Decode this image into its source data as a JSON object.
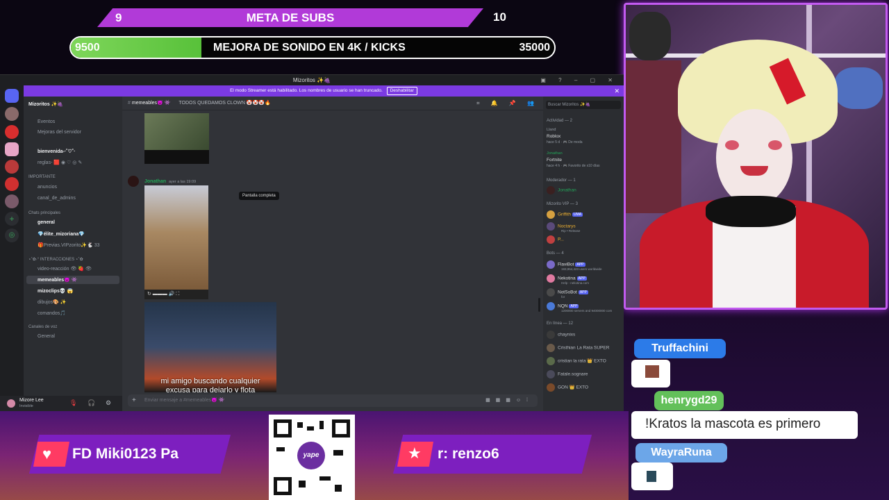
{
  "overlay": {
    "subs_goal": {
      "left": "9",
      "title": "META DE SUBS",
      "right": "10"
    },
    "kicks_goal": {
      "current": "9500",
      "title": "MEJORA DE SONIDO EN 4K / KICKS",
      "target": "35000",
      "progress": 0.27
    }
  },
  "discord": {
    "window_title": "Mizoritos ✨🍇",
    "banner": {
      "text": "El modo Streamer está habilitado. Los nombres de usuario se han truncado.",
      "button": "Deshabilitar"
    },
    "server_name": "Mizoritos ✨🍇",
    "sidebar": {
      "events": "Eventos",
      "boost": "Mejoras del servidor",
      "channels_top": [
        "bienvenida-‧˚♡˚‧",
        "reglas- 🟥 ◉ ♡ ◎ ✎"
      ],
      "cat_important": "IMPORTANTE",
      "important": [
        "anuncios",
        "canal_de_admins"
      ],
      "cat_chats": "Chats principales",
      "chats": [
        "general",
        "💎élite_mizoriana💎",
        "🎁Previas.VIPzorito✨🐇 33"
      ],
      "cat_inter": "⋆˚✿˖° INTERACCIONES ⋆˚✿",
      "inter": [
        "video-reacción 👁 🍓 👁",
        "memeables😈 👾",
        "mizoclips💀 😱",
        "dibujos🎨 ✨",
        "comandos🎵"
      ],
      "cat_voice": "Canales de voz",
      "voice": [
        "General"
      ],
      "user": {
        "name": "Mizore Lee",
        "status": "Invisible"
      }
    },
    "chat": {
      "channel": "memeables😈 👾",
      "topic": "TODOS QUEDAMOS CLOWN 🤡🤡🤡🔥",
      "author": "Jonathan",
      "time": "ayer a las 19:09",
      "tooltip": "Pantalla completa",
      "video_caption_line1": "mi amigo buscando cualquier",
      "video_caption_line2": "excusa para dejarlo y flota",
      "input_placeholder": "Enviar mensaje a #memeables😈 👾"
    },
    "members": {
      "search": "Buscar Mizoritos ✨🍇",
      "activity_cat": "Actividad — 2",
      "activity": [
        {
          "name": "Lland",
          "game": "Roblox",
          "detail": "hace 5 d  · 🎮 De moda"
        },
        {
          "name": "Jonathan",
          "game": "Fortnite",
          "detail": "hace 4 h · 🎮 Favorito de x10 días"
        }
      ],
      "mod_cat": "Moderador — 1",
      "mods": [
        "Jonathan"
      ],
      "vip_cat": "Mizorito VIP — 3",
      "vips": [
        "Griffith",
        "Noctarys",
        "P..."
      ],
      "vip_sub": [
        "UMA",
        "Rip • Release"
      ],
      "bots_cat": "Bots — 4",
      "bots": [
        {
          "name": "FlaviBot",
          "sub": "193,954,423 users worldwide"
        },
        {
          "name": "Nekotina",
          "sub": "Help - nekotina.com"
        },
        {
          "name": "NotSoBot",
          "sub": "for"
        },
        {
          "name": "NQN",
          "sub": "1200000 servers and 94000000 com"
        }
      ],
      "app_tag": "APP",
      "online_cat": "En línea — 12",
      "online": [
        "chaynixs",
        "Cristhian La Rata SUPER",
        "cristian la rata 👑 EXTO",
        "Fatale.sognare",
        "GON 👑 EXTO"
      ]
    }
  },
  "alerts": {
    "left": "FD    Miki0123    Pa",
    "right": "r: renzo6"
  },
  "qr": {
    "label": "yape"
  },
  "chat_overlay": {
    "users": [
      "Truffachini",
      "henrygd29",
      "WayraRuna"
    ],
    "message": "!Kratos la mascota es primero"
  }
}
